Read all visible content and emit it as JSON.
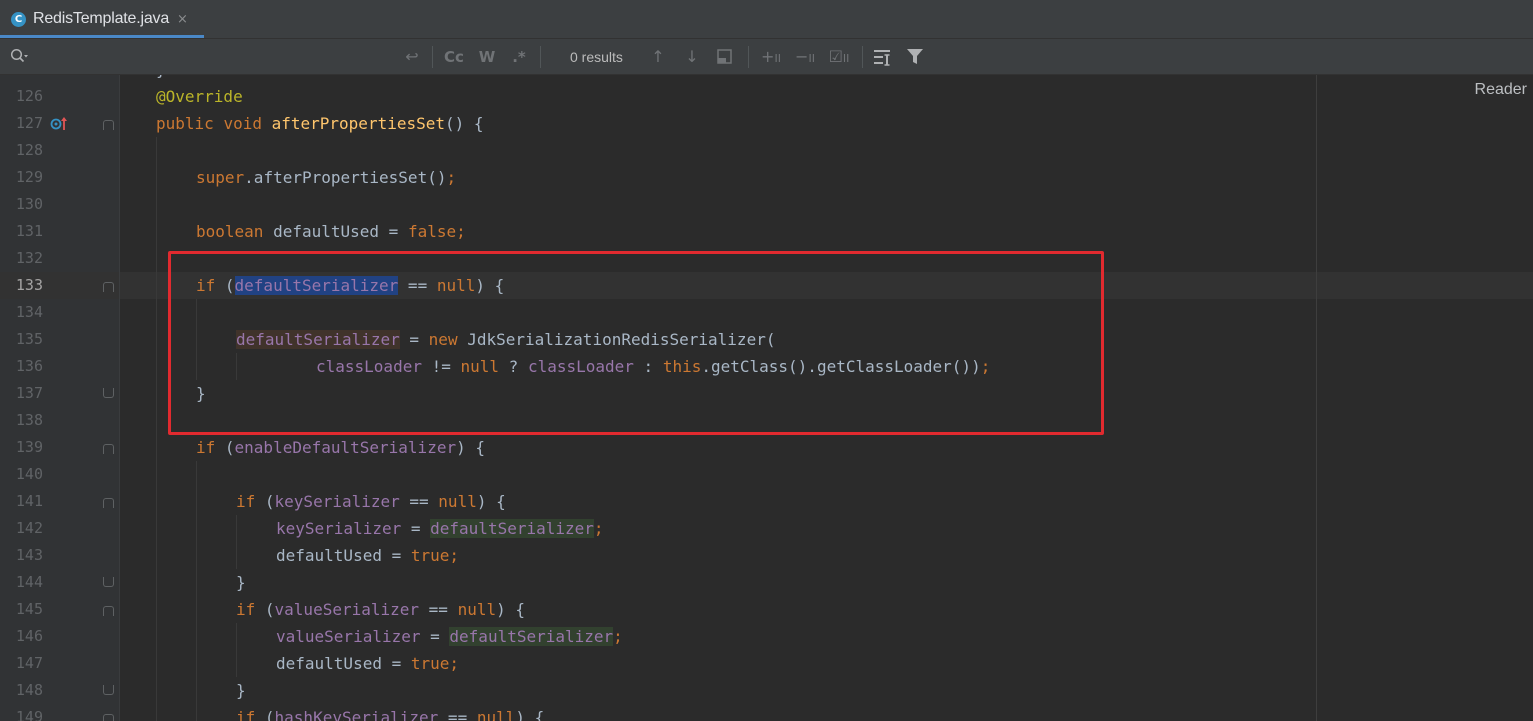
{
  "tab": {
    "icon_letter": "C",
    "filename": "RedisTemplate.java",
    "close": "×"
  },
  "search": {
    "value": "",
    "placeholder": "",
    "results": "0 results",
    "icons": [
      "search-icon",
      "newline-icon",
      "match-case-icon",
      "whole-word-icon",
      "regex-icon",
      "prev-occurrence-icon",
      "next-occurrence-icon",
      "open-in-window-icon",
      "add-selection-icon",
      "remove-selection-icon",
      "select-all-icon",
      "filter-lines-icon",
      "filter-icon"
    ]
  },
  "editor": {
    "reader_mode": "Reader",
    "current_line": "133",
    "lines": [
      {
        "n": "126"
      },
      {
        "n": "127"
      },
      {
        "n": "128"
      },
      {
        "n": "129"
      },
      {
        "n": "130"
      },
      {
        "n": "131"
      },
      {
        "n": "132"
      },
      {
        "n": "133"
      },
      {
        "n": "134"
      },
      {
        "n": "135"
      },
      {
        "n": "136"
      },
      {
        "n": "137"
      },
      {
        "n": "138"
      },
      {
        "n": "139"
      },
      {
        "n": "140"
      },
      {
        "n": "141"
      },
      {
        "n": "142"
      },
      {
        "n": "143"
      },
      {
        "n": "144"
      },
      {
        "n": "145"
      },
      {
        "n": "146"
      },
      {
        "n": "147"
      },
      {
        "n": "148"
      },
      {
        "n": "149"
      }
    ],
    "t": {
      "override": "@Override",
      "public": "public",
      "void": "void",
      "afterPropertiesSet": "afterPropertiesSet",
      "parens_brace": "() {",
      "super": "super",
      "super_call": ".afterPropertiesSet()",
      "semicolon": ";",
      "boolean": "boolean",
      "defaultUsed": "defaultUsed",
      "assign": " = ",
      "false": "false",
      "true": "true",
      "if": "if",
      "open_paren": " (",
      "defaultSerializer": "defaultSerializer",
      "eq_null_left": " == ",
      "null": "null",
      "close_brace_open": ") {",
      "new": "new",
      "jdk_ctor": " JdkSerializationRedisSerializer(",
      "classLoader": "classLoader",
      "neq": " != ",
      "ternary_q": " ? ",
      "ternary_c": " : ",
      "this": "this",
      "getclass_chain": ".getClass().getClassLoader())",
      "close_brace": "}",
      "enableDefaultSerializer": "enableDefaultSerializer",
      "keySerializer": "keySerializer",
      "valueSerializer": "valueSerializer",
      "hashKeySerializer": "hashKeySerializer",
      "line125_partial": "}"
    }
  }
}
